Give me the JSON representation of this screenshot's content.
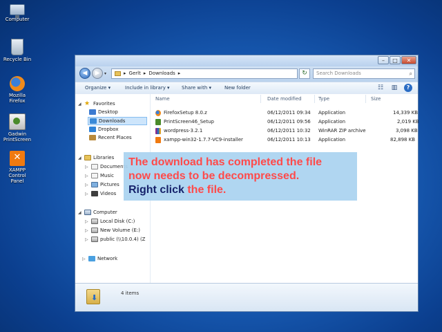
{
  "desktop": {
    "icons": [
      {
        "name": "computer",
        "label": "Computer"
      },
      {
        "name": "recycle-bin",
        "label": "Recycle Bin"
      },
      {
        "name": "firefox",
        "label": "Mozilla Firefox"
      },
      {
        "name": "gadwin",
        "label": "Gadwin PrintScreen"
      },
      {
        "name": "xampp",
        "label": "XAMPP Control Panel"
      }
    ]
  },
  "window": {
    "address": {
      "root": "Gerlt",
      "folder": "Downloads"
    },
    "search_placeholder": "Search Downloads",
    "toolbar": {
      "organize": "Organize ▾",
      "include": "Include in library ▾",
      "share": "Share with ▾",
      "new_folder": "New folder"
    },
    "nav": {
      "favorites": "Favorites",
      "favorites_items": [
        "Desktop",
        "Downloads",
        "Dropbox",
        "Recent Places"
      ],
      "libraries": "Libraries",
      "libraries_items": [
        "Documents",
        "Music",
        "Pictures",
        "Videos"
      ],
      "computer": "Computer",
      "computer_items": [
        "Local Disk (C:)",
        "New Volume (E:)",
        "public (\\\\10.0.4) (Z"
      ],
      "network": "Network"
    },
    "columns": {
      "name": "Name",
      "date": "Date modified",
      "type": "Type",
      "size": "Size"
    },
    "files": [
      {
        "name": "FirefoxSetup 8.0.z",
        "date": "06/12/2011 09:34",
        "type": "Application",
        "size": "14,339 KB"
      },
      {
        "name": "PrintScreen46_Setup",
        "date": "06/12/2011 09:56",
        "type": "Application",
        "size": "2,019 KB"
      },
      {
        "name": "wordpress-3.2.1",
        "date": "06/12/2011 10:32",
        "type": "WinRAR ZIP archive",
        "size": "3,098 KB"
      },
      {
        "name": "xampp-win32-1.7.7-VC9-installer",
        "date": "06/12/2011 10:13",
        "type": "Application",
        "size": "82,898 KB"
      }
    ],
    "status": "4 items"
  },
  "callout": {
    "line1": "The download has completed the file",
    "line2": "now needs to be decompressed.",
    "line3_emph": "Right click",
    "line3_rest": " the file."
  }
}
